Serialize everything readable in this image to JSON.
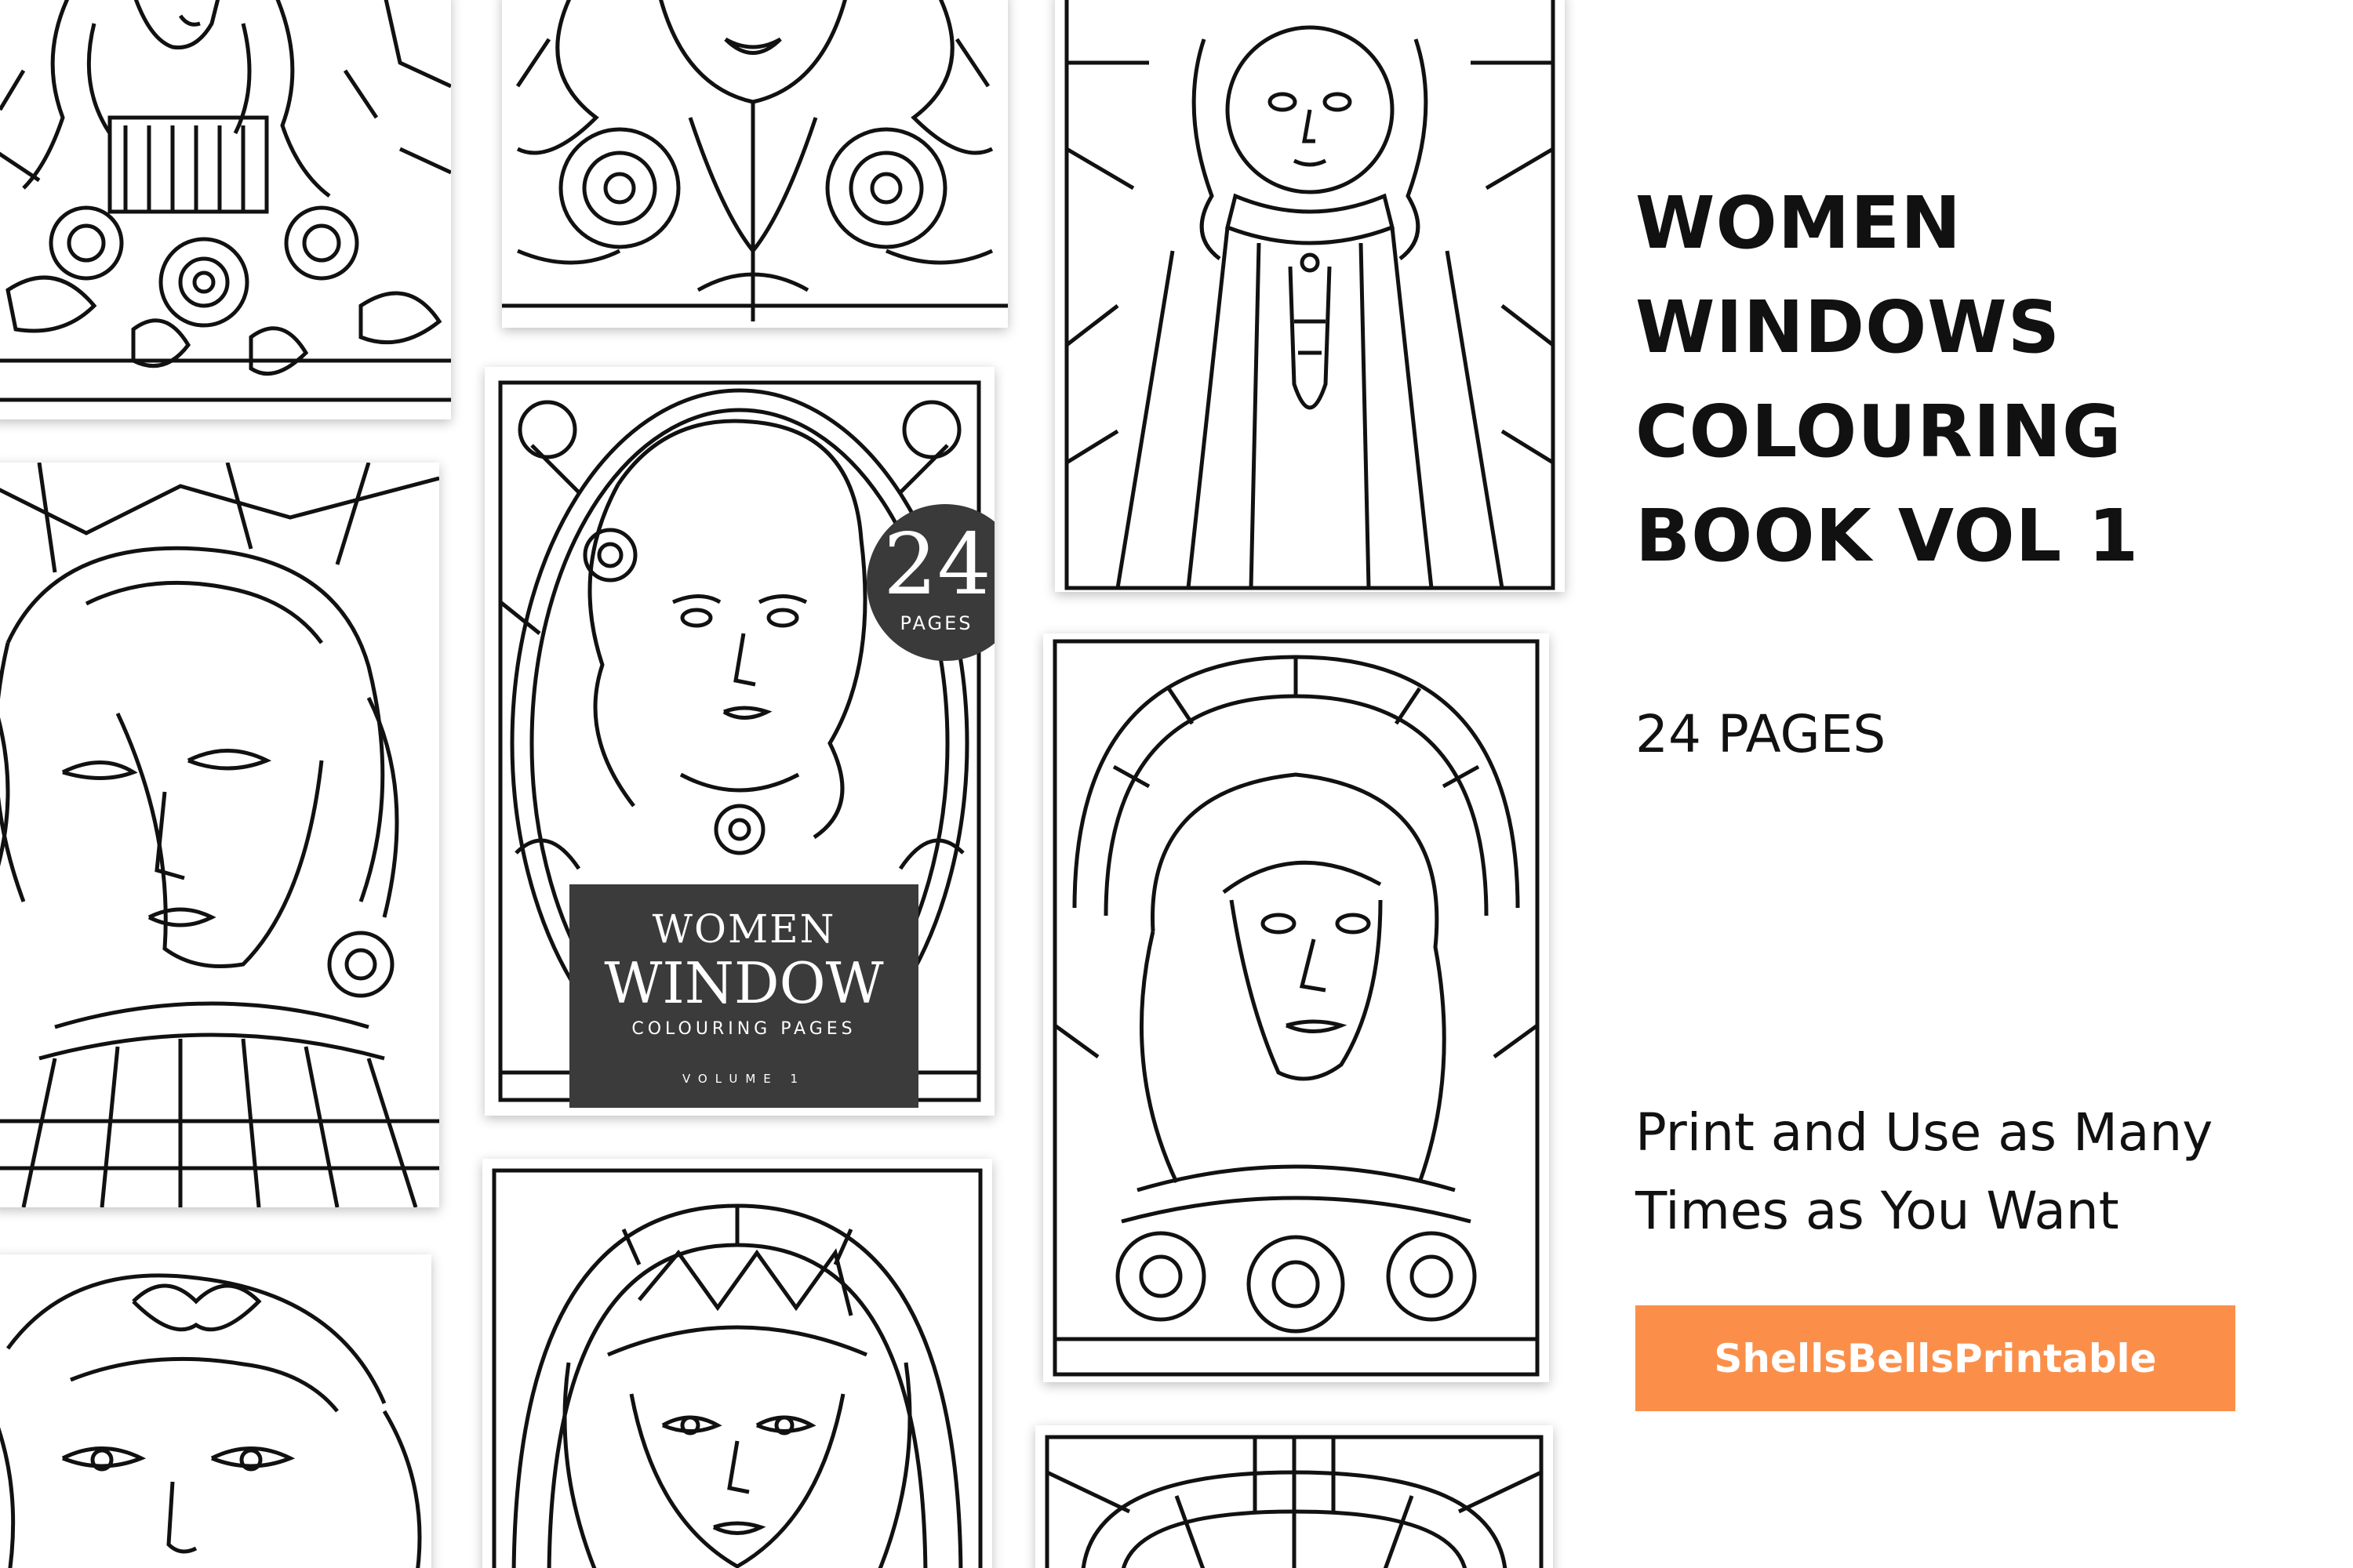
{
  "product": {
    "title_lines": [
      "WOMEN",
      "WINDOWS",
      "COLOURING",
      "BOOK VOL 1"
    ],
    "page_count": "24 PAGES",
    "tagline_lines": [
      "Print and Use as Many",
      "Times as You Want"
    ],
    "shop_button": "ShellsBellsPrintable"
  },
  "cover": {
    "badge_number": "24",
    "badge_label": "PAGES",
    "title_line1": "WOMEN",
    "title_line2": "WINDOW",
    "subtitle": "COLOURING PAGES",
    "volume": "VOLUME 1"
  },
  "colors": {
    "accent": "#fb8f4a",
    "cover_dark": "#3b3b3b",
    "ink": "#111111",
    "background": "#ffffff"
  }
}
